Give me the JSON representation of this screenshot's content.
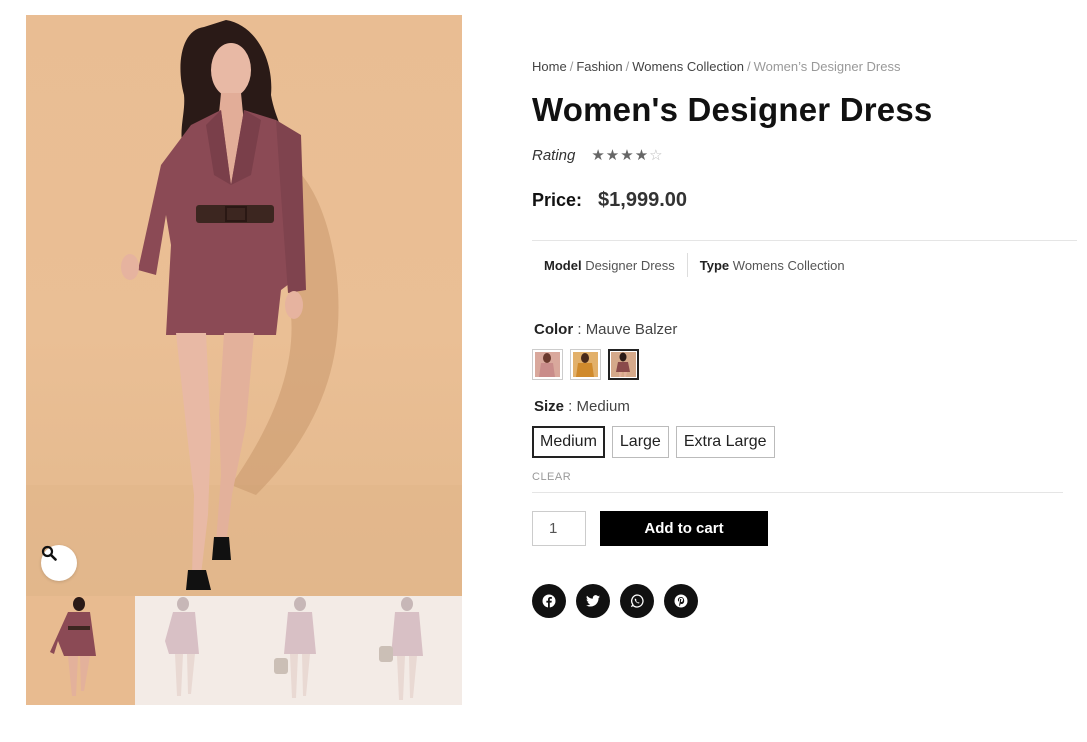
{
  "breadcrumb": {
    "items": [
      "Home",
      "Fashion",
      "Womens Collection"
    ],
    "current": "Women’s Designer Dress",
    "separator": "/"
  },
  "product": {
    "title": "Women's Designer Dress",
    "rating_label": "Rating",
    "rating": 4,
    "rating_max": 5,
    "stars_filled": "★★★★",
    "stars_empty": "☆",
    "price_label": "Price:",
    "price": "$1,999.00"
  },
  "meta": {
    "model_label": "Model",
    "model_value": "Designer Dress",
    "type_label": "Type",
    "type_value": "Womens Collection"
  },
  "variations": {
    "color_label": "Color",
    "color_value": "Mauve Balzer",
    "swatches": [
      {
        "name": "pink",
        "color": "#c98c8a",
        "selected": false
      },
      {
        "name": "mustard",
        "color": "#d08a2c",
        "selected": false
      },
      {
        "name": "mauve",
        "color": "#8a4a4a",
        "selected": true
      }
    ],
    "size_label": "Size",
    "size_value": "Medium",
    "sizes": [
      "Medium",
      "Large",
      "Extra Large"
    ],
    "selected_size": "Medium",
    "clear_label": "CLEAR"
  },
  "cart": {
    "quantity": "1",
    "add_label": "Add to cart",
    "button_color": "#000000"
  },
  "share": {
    "icons": [
      "facebook-icon",
      "twitter-icon",
      "whatsapp-icon",
      "pinterest-icon"
    ]
  },
  "gallery": {
    "thumb_count": 4,
    "active_thumb": 0,
    "zoom_icon": "magnifier-icon"
  },
  "colors": {
    "background": "#ffffff",
    "photo_backdrop": "#e9bd93",
    "dress": "#8b4a55",
    "text_muted": "#999999"
  }
}
